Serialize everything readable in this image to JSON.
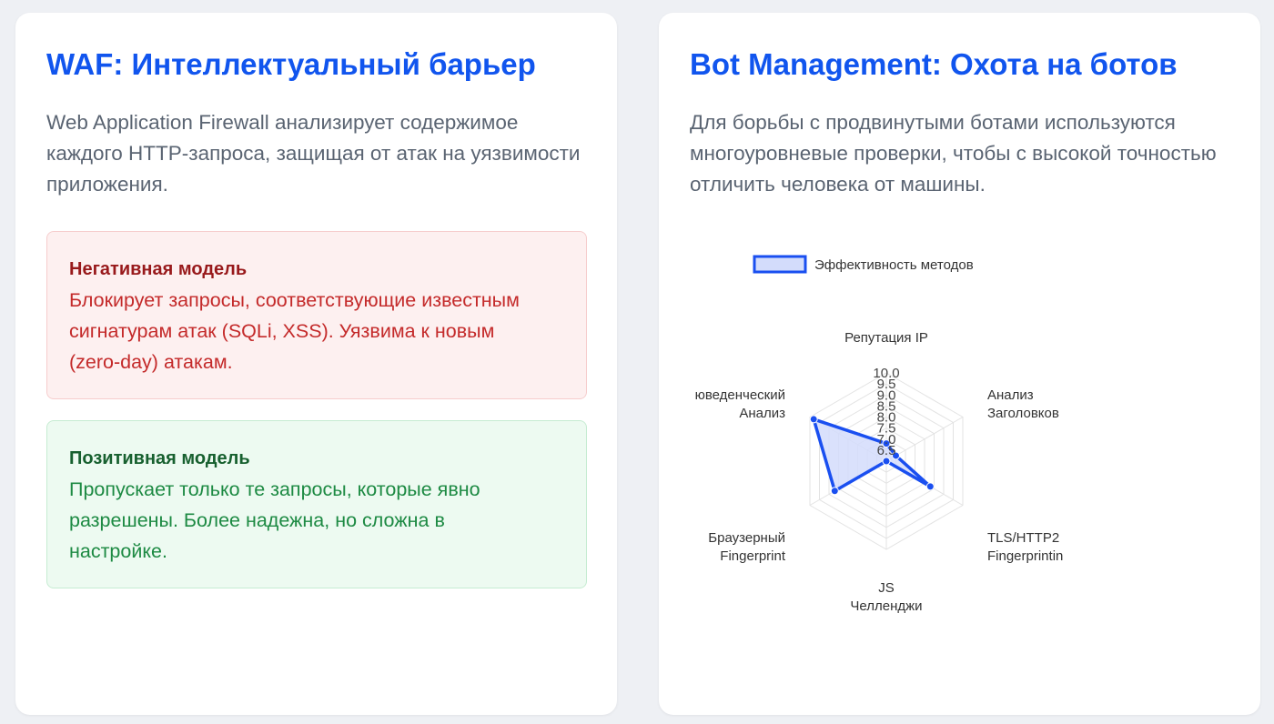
{
  "waf": {
    "title": "WAF: Интеллектуальный барьер",
    "description": "Web Application Firewall анализирует содержимое каждого HTTP-запроса, защищая от атак на уязвимости приложения.",
    "negative": {
      "title": "Негативная модель",
      "description": "Блокирует запросы, соответствующие известным сигнатурам атак (SQLi, XSS). Уязвима к новым (zero-day) атакам."
    },
    "positive": {
      "title": "Позитивная модель",
      "description": "Пропускает только те запросы, которые явно разрешены. Более надежна, но сложна в настройке."
    }
  },
  "bot": {
    "title": "Bot Management: Охота на ботов",
    "description": "Для борьбы с продвинутыми ботами используются многоуровневые проверки, чтобы с высокой точностью отличить человека от машины."
  },
  "colors": {
    "title": "#1155ee",
    "series_line": "#1a4ff0",
    "series_fill": "#d3dcfb"
  },
  "chart_data": {
    "type": "radar",
    "legend_position": "top",
    "grid": true,
    "axes": [
      [
        "Репутация IP"
      ],
      [
        "Анализ",
        "Заголовков"
      ],
      [
        "TLS/HTTP2",
        "Fingerprintin"
      ],
      [
        "JS",
        "Челленджи"
      ],
      [
        "Браузерный",
        "Fingerprint"
      ],
      [
        "юведенческий",
        "Анализ"
      ]
    ],
    "r_min": 6.0,
    "r_max": 10.0,
    "r_ticks": [
      "6.5",
      "7.0",
      "7.5",
      "8.0",
      "8.5",
      "9.0",
      "9.5",
      "10.0"
    ],
    "series": [
      {
        "name": "Эффективность методов",
        "values": [
          6.8,
          6.5,
          8.3,
          6.0,
          8.7,
          9.8
        ]
      }
    ]
  }
}
